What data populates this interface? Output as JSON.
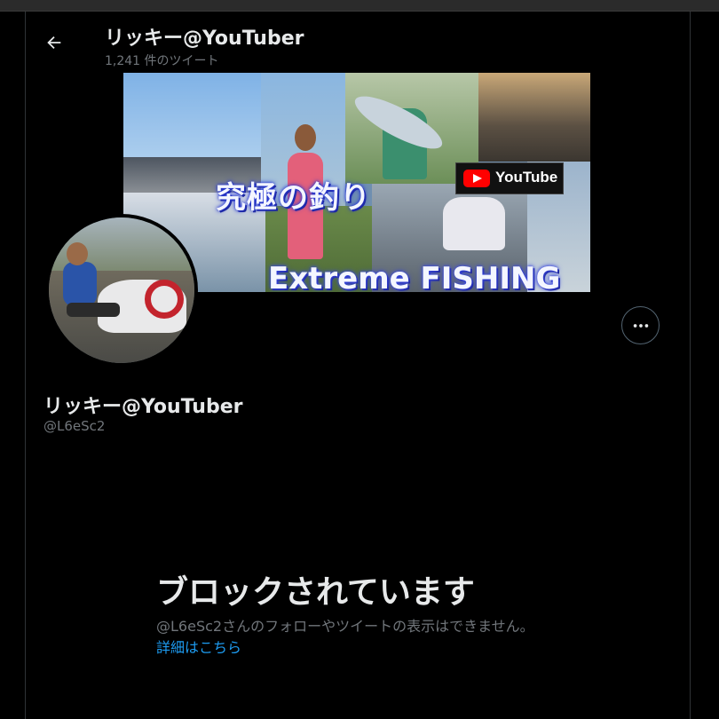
{
  "header": {
    "back_icon": "arrow-left-icon",
    "title": "リッキー@YouTuber",
    "tweet_count": "1,241 件のツイート"
  },
  "banner": {
    "title_jp": "究極の釣り",
    "title_en": "Extreme FISHING",
    "youtube_label": "YouTube"
  },
  "profile": {
    "display_name": "リッキー@YouTuber",
    "handle": "@L6eSc2",
    "more_icon": "more-horizontal-icon"
  },
  "blocked": {
    "title": "ブロックされています",
    "description": "@L6eSc2さんのフォローやツイートの表示はできません。",
    "link_label": "詳細はこちら"
  },
  "colors": {
    "background": "#000000",
    "text_primary": "#e7e9ea",
    "text_secondary": "#71767b",
    "link": "#1d9bf0",
    "border": "#2f3336"
  }
}
